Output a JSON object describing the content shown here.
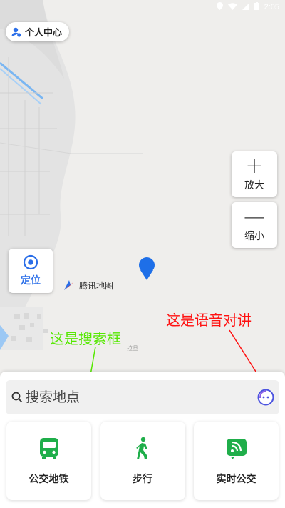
{
  "status_bar": {
    "time": "2:05"
  },
  "header": {
    "profile_label": "个人中心"
  },
  "map": {
    "zoom_in": {
      "symbol": "+",
      "label": "放大"
    },
    "zoom_out": {
      "symbol": "—",
      "label": "缩小"
    },
    "locate": {
      "label": "定位"
    },
    "logo_text": "腾讯地图",
    "poi_label": "拉旦",
    "annotation_search": "这是搜索框",
    "annotation_voice": "这是语音对讲"
  },
  "search": {
    "placeholder": "搜索地点"
  },
  "tiles": [
    {
      "label": "公交地铁",
      "icon": "bus-icon"
    },
    {
      "label": "步行",
      "icon": "walk-icon"
    },
    {
      "label": "实时公交",
      "icon": "realtime-bus-icon"
    }
  ],
  "colors": {
    "accent_blue": "#2a6ee8",
    "tile_green": "#1fae4a",
    "annotation_green": "#55e800",
    "annotation_red": "#ff1111"
  }
}
